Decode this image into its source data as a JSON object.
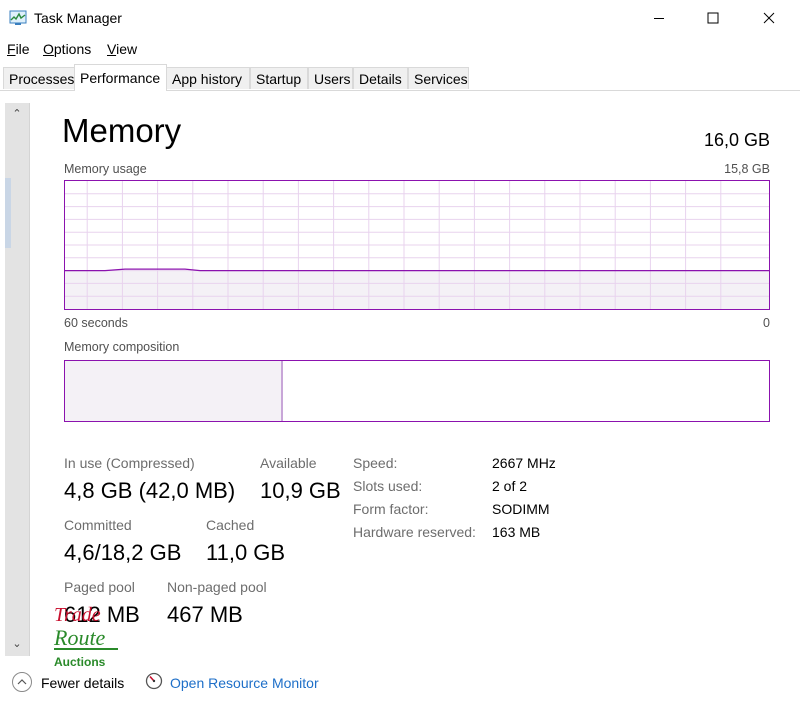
{
  "window": {
    "title": "Task Manager",
    "controls": {
      "minimize": "minimize-icon",
      "maximize": "maximize-icon",
      "close": "close-icon"
    }
  },
  "menu": {
    "items": [
      {
        "label": "File",
        "underline": "F"
      },
      {
        "label": "Options",
        "underline": "O"
      },
      {
        "label": "View",
        "underline": "V"
      }
    ]
  },
  "tabs": [
    {
      "label": "Processes",
      "active": false
    },
    {
      "label": "Performance",
      "active": true
    },
    {
      "label": "App history",
      "active": false
    },
    {
      "label": "Startup",
      "active": false
    },
    {
      "label": "Users",
      "active": false
    },
    {
      "label": "Details",
      "active": false
    },
    {
      "label": "Services",
      "active": false
    }
  ],
  "memory": {
    "heading": "Memory",
    "total": "16,0 GB",
    "usage_graph": {
      "label": "Memory usage",
      "max_label": "15,8 GB",
      "left_axis": "60 seconds",
      "right_axis": "0",
      "used_fraction": 0.3,
      "color": "#8b12ae"
    },
    "composition": {
      "label": "Memory composition",
      "in_use_fraction": 0.31,
      "color": "#8b12ae"
    },
    "stats": {
      "in_use": {
        "label": "In use (Compressed)",
        "value": "4,8 GB (42,0 MB)"
      },
      "available": {
        "label": "Available",
        "value": "10,9 GB"
      },
      "committed": {
        "label": "Committed",
        "value": "4,6/18,2 GB"
      },
      "cached": {
        "label": "Cached",
        "value": "11,0 GB"
      },
      "paged_pool": {
        "label": "Paged pool",
        "value": "612 MB"
      },
      "non_paged_pool": {
        "label": "Non-paged pool",
        "value": "467 MB"
      }
    },
    "specs": {
      "speed": {
        "label": "Speed:",
        "value": "2667 MHz"
      },
      "slots": {
        "label": "Slots used:",
        "value": "2 of 2"
      },
      "form_factor": {
        "label": "Form factor:",
        "value": "SODIMM"
      },
      "hw_reserved": {
        "label": "Hardware reserved:",
        "value": "163 MB"
      }
    }
  },
  "footer": {
    "fewer_details": "Fewer details",
    "open_resource_monitor": "Open Resource Monitor"
  },
  "watermark": {
    "line1": "Trade",
    "line2": "Route",
    "line3": "Auctions"
  },
  "colors": {
    "accent": "#8b12ae",
    "link": "#1e6fc8",
    "grid": "#e8d3ee"
  }
}
